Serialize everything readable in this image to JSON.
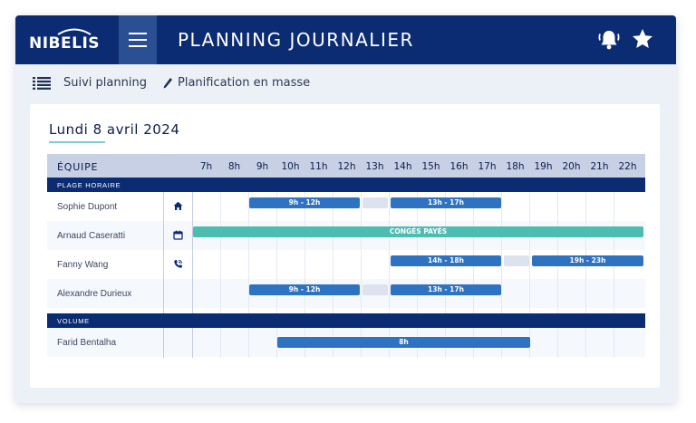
{
  "header": {
    "logo": "NIBELIS",
    "title": "PLANNING JOURNALIER",
    "icons": [
      "bell-icon",
      "star-icon",
      "menu-icon"
    ]
  },
  "toolbar": {
    "suivi_label": "Suivi planning",
    "planification_label": "Planification en masse"
  },
  "date": "Lundi 8 avril 2024",
  "grid": {
    "team_label": "ÉQUIPE",
    "hours": [
      "7h",
      "8h",
      "9h",
      "10h",
      "11h",
      "12h",
      "13h",
      "14h",
      "15h",
      "16h",
      "17h",
      "18h",
      "19h",
      "20h",
      "21h",
      "22h"
    ],
    "section_plage": "PLAGE HORAIRE",
    "section_volume": "VOLUME",
    "employees": [
      {
        "name": "Sophie Dupont",
        "icon": "home-icon",
        "shifts": [
          "9h - 12h",
          "13h - 17h"
        ]
      },
      {
        "name": "Arnaud Caseratti",
        "icon": "calendar-icon",
        "shifts": [
          "CONGÉS PAYÉS"
        ]
      },
      {
        "name": "Fanny Wang",
        "icon": "phone-icon",
        "shifts": [
          "14h - 18h",
          "19h - 23h"
        ]
      },
      {
        "name": "Alexandre Durieux",
        "icon": "",
        "shifts": [
          "9h - 12h",
          "13h - 17h"
        ]
      },
      {
        "name": "Farid Bentalha",
        "icon": "",
        "shifts": [
          "8h"
        ]
      }
    ]
  },
  "colors": {
    "navy": "#0b2c72",
    "shift_blue": "#2e72c2",
    "leave_teal": "#4bbdb1",
    "header_grey": "#c7d0e4"
  }
}
